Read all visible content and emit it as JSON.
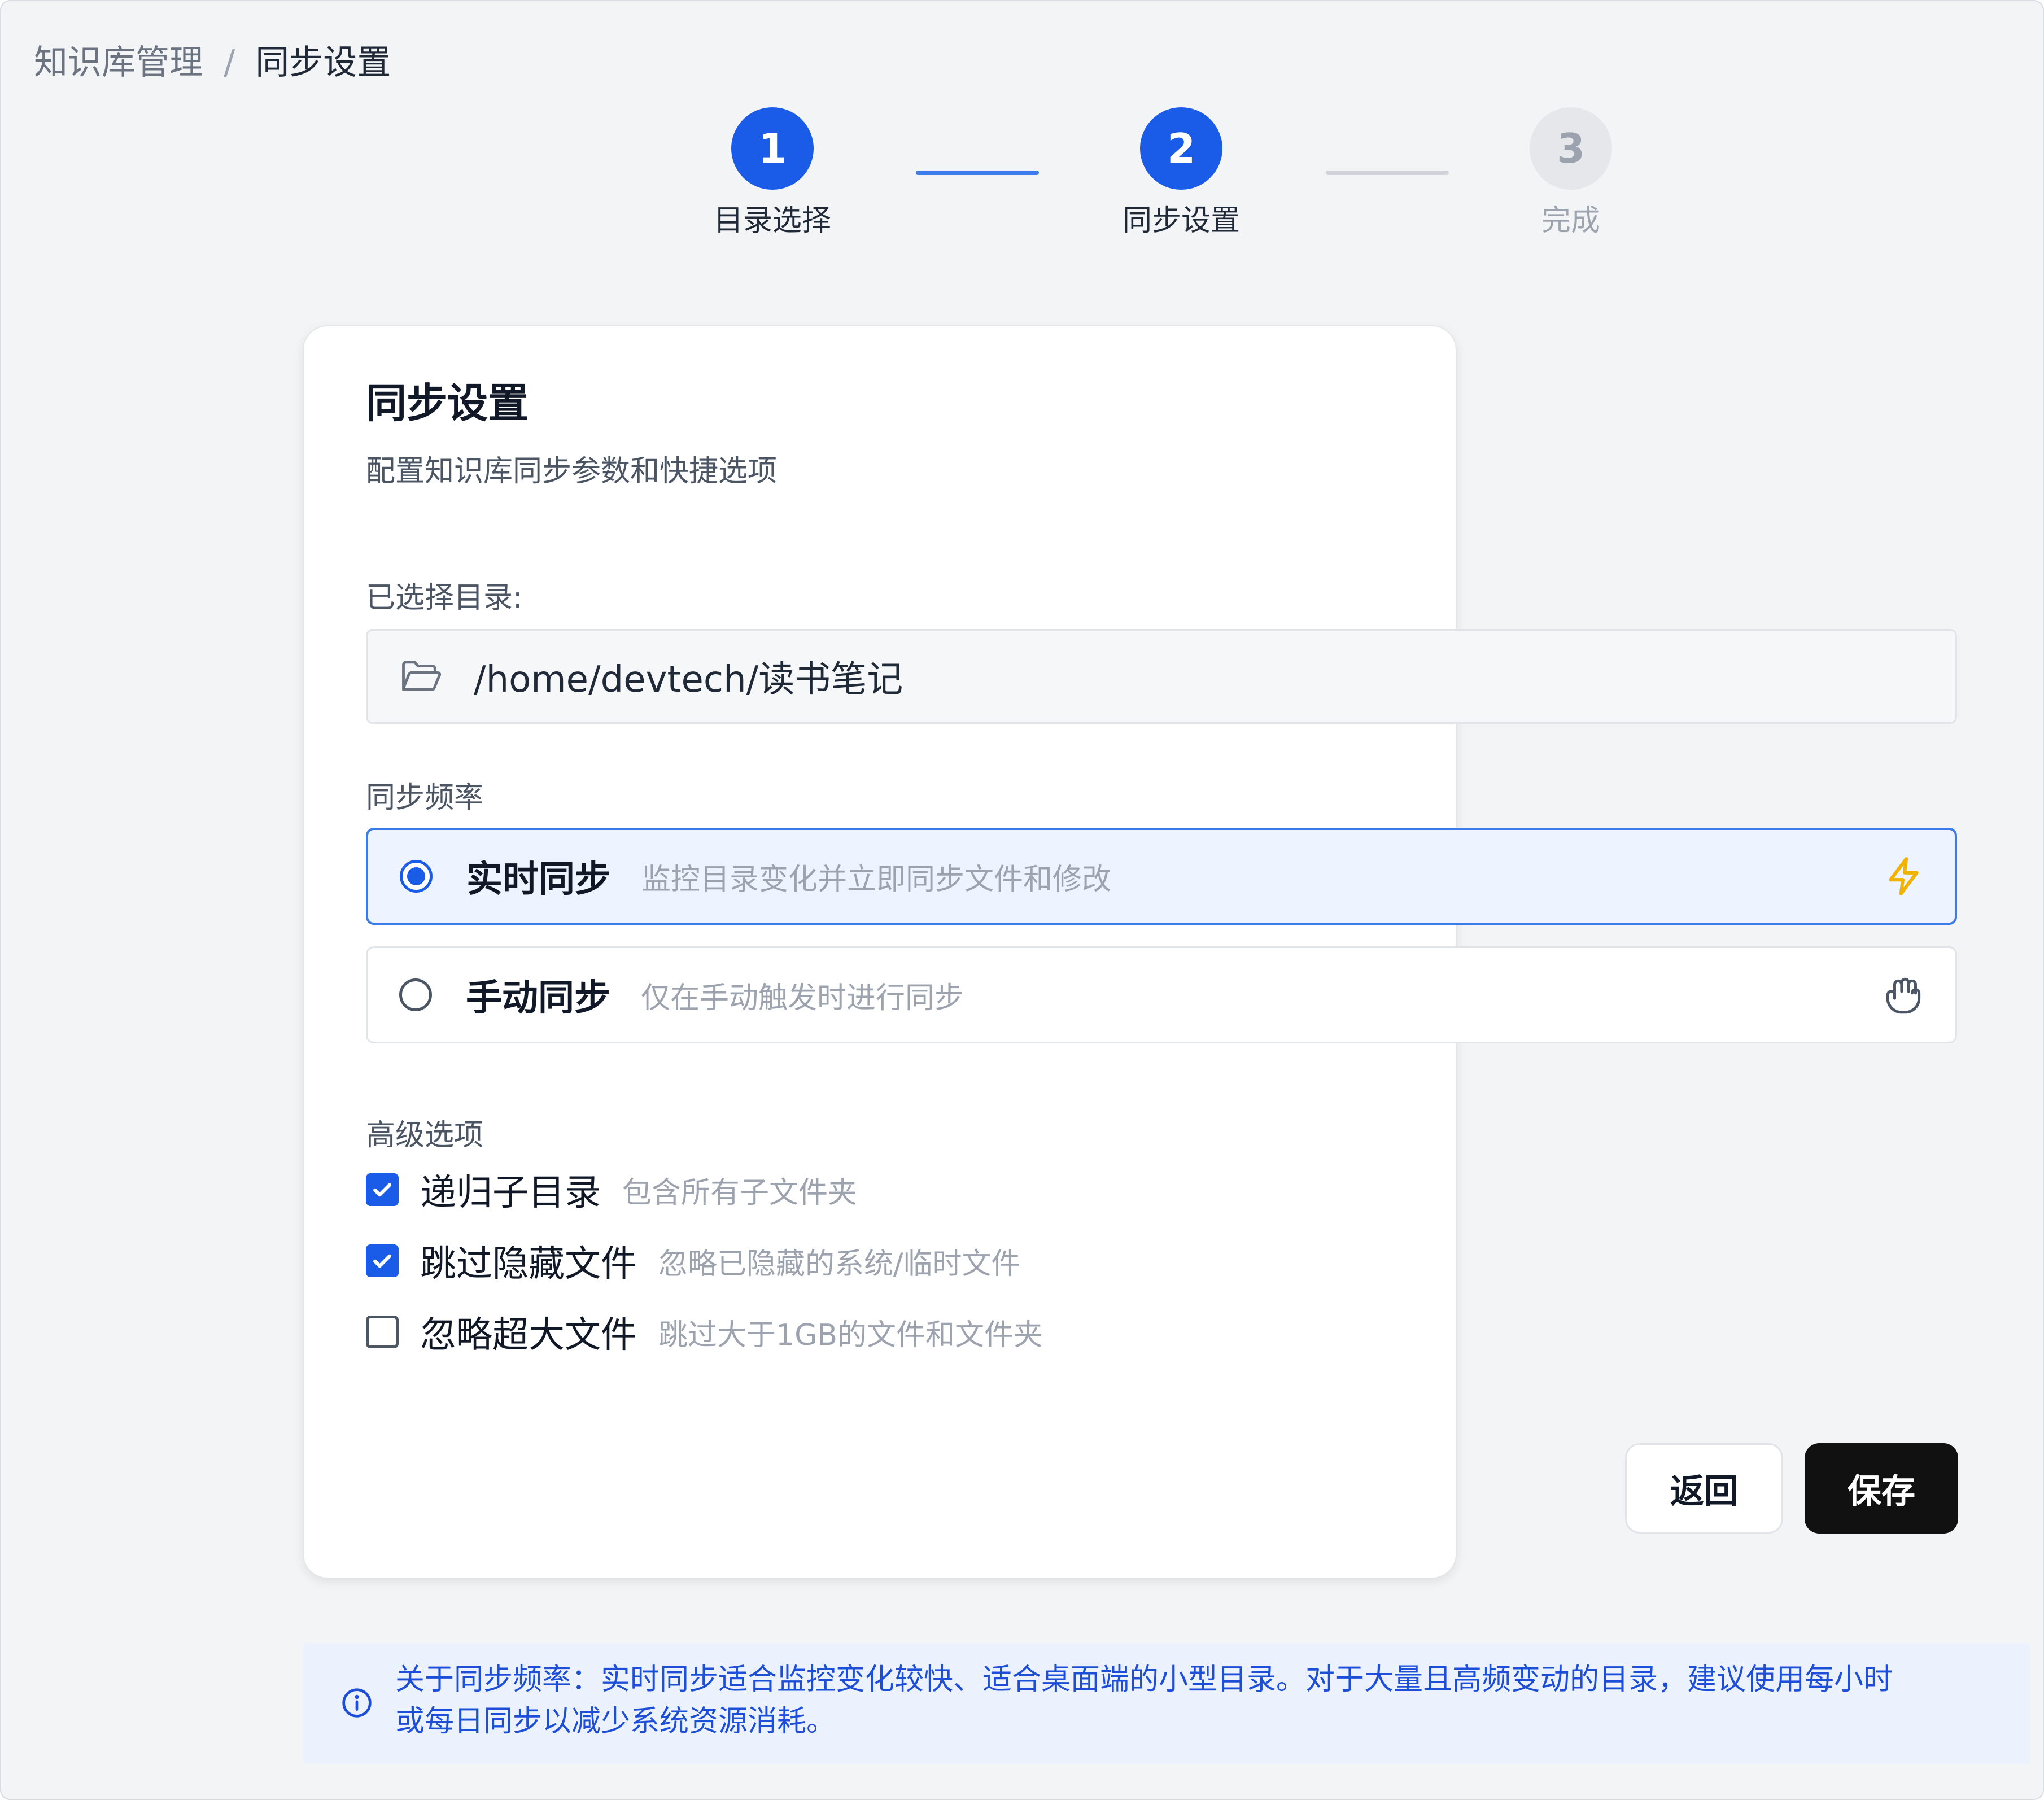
{
  "breadcrumb": {
    "parent": "知识库管理",
    "separator": "/",
    "current": "同步设置"
  },
  "stepper": {
    "steps": [
      {
        "number": "1",
        "label": "目录选择",
        "state": "active"
      },
      {
        "number": "2",
        "label": "同步设置",
        "state": "active"
      },
      {
        "number": "3",
        "label": "完成",
        "state": "inactive"
      }
    ]
  },
  "card": {
    "title": "同步设置",
    "subtitle": "配置知识库同步参数和快捷选项",
    "directory": {
      "label": "已选择目录:",
      "path": "/home/devtech/读书笔记",
      "icon": "folder-open-icon"
    },
    "frequency": {
      "label": "同步频率",
      "options": [
        {
          "title": "实时同步",
          "description": "监控目录变化并立即同步文件和修改",
          "selected": true,
          "icon": "lightning-icon"
        },
        {
          "title": "手动同步",
          "description": "仅在手动触发时进行同步",
          "selected": false,
          "icon": "hand-icon"
        }
      ]
    },
    "advanced": {
      "label": "高级选项",
      "options": [
        {
          "title": "递归子目录",
          "description": "包含所有子文件夹",
          "checked": true
        },
        {
          "title": "跳过隐藏文件",
          "description": "忽略已隐藏的系统/临时文件",
          "checked": true
        },
        {
          "title": "忽略超大文件",
          "description": "跳过大于1GB的文件和文件夹",
          "checked": false
        }
      ]
    },
    "buttons": {
      "back": "返回",
      "save": "保存"
    }
  },
  "info": {
    "icon": "info-icon",
    "line1": "关于同步频率：实时同步适合监控变化较快、适合桌面端的小型目录。对于大量且高频变动的目录，建议使用每小时",
    "line2": "或每日同步以减少系统资源消耗。"
  },
  "colors": {
    "accent": "#1a5ce8",
    "save_button": "#111111",
    "info_background": "#ecf2fd",
    "info_text": "#1d4ed8",
    "lightning": "#f2b300"
  }
}
